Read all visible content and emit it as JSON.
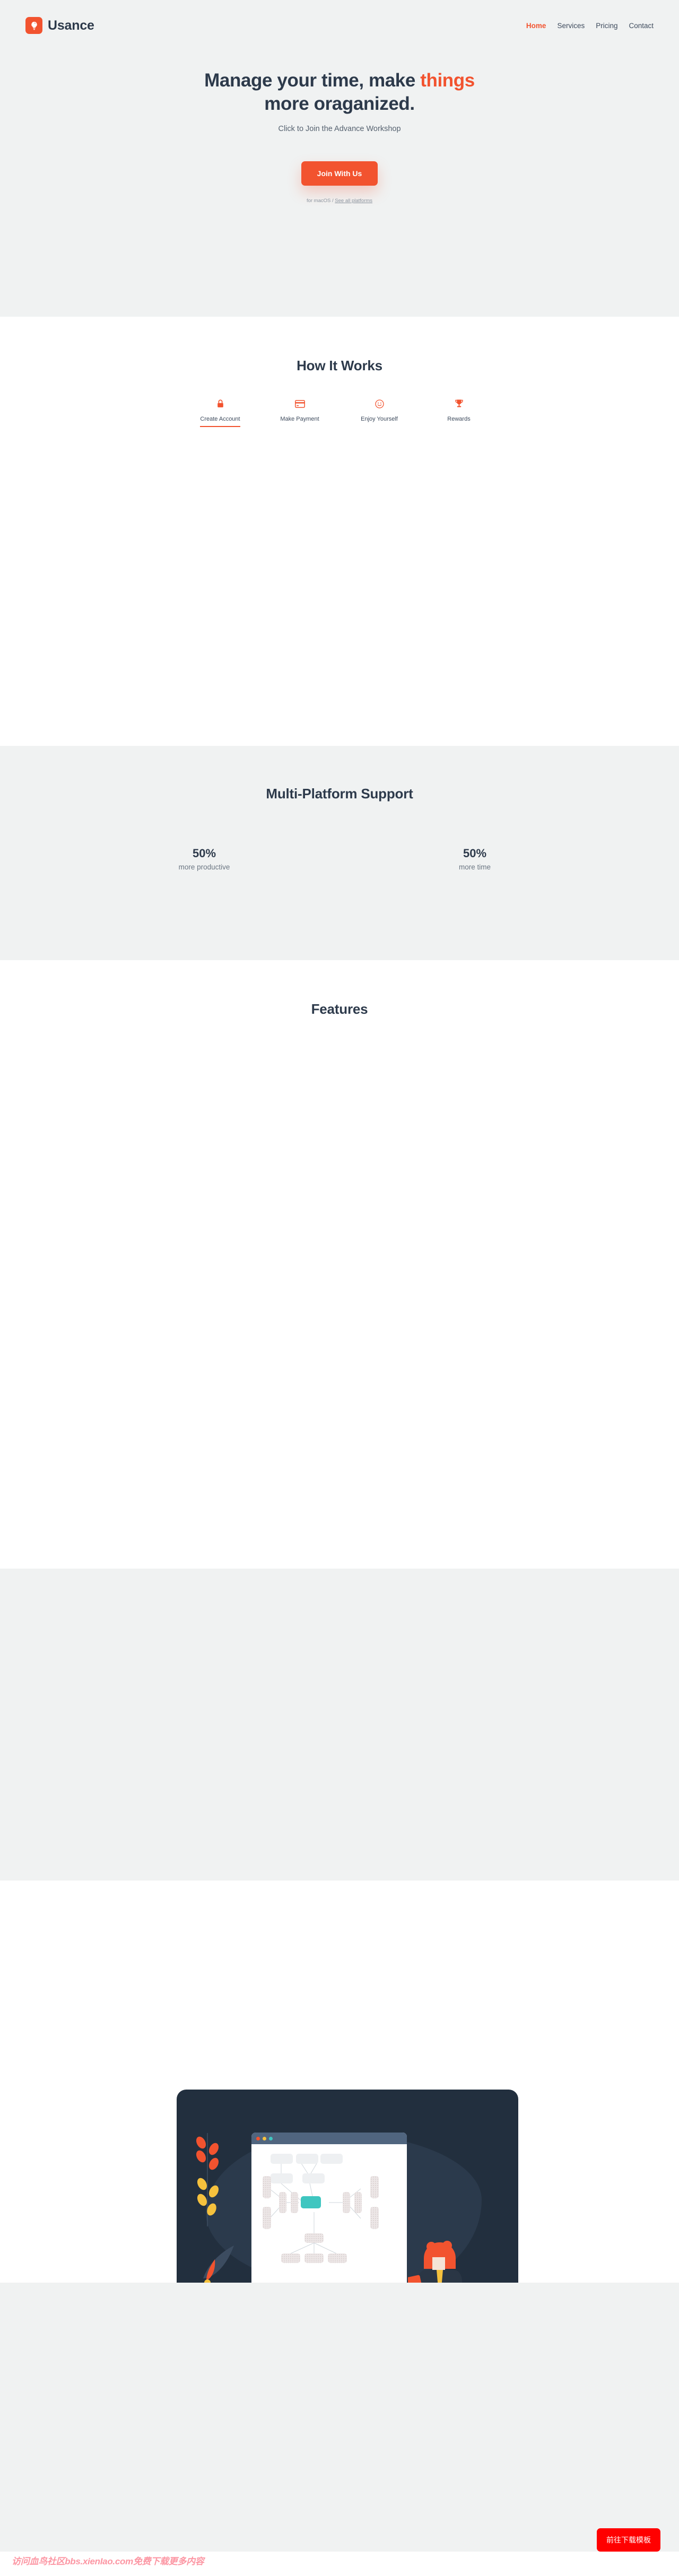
{
  "header": {
    "brand_name": "Usance",
    "logo_icon": "lightbulb-icon",
    "nav": [
      {
        "label": "Home",
        "active": true
      },
      {
        "label": "Services",
        "active": false
      },
      {
        "label": "Pricing",
        "active": false
      },
      {
        "label": "Contact",
        "active": false
      }
    ]
  },
  "hero": {
    "title_part1": "Manage your time, make ",
    "title_accent": "things",
    "title_part2": "more oraganized.",
    "subtitle": "Click to Join the Advance Workshop",
    "cta_label": "Join With Us",
    "note_prefix": "for macOS / ",
    "note_link": "See all platforms"
  },
  "how_it_works": {
    "title": "How It Works",
    "steps": [
      {
        "label": "Create Account",
        "icon": "lock-icon",
        "active": true
      },
      {
        "label": "Make Payment",
        "icon": "credit-card-icon",
        "active": false
      },
      {
        "label": "Enjoy Yourself",
        "icon": "smiley-icon",
        "active": false
      },
      {
        "label": "Rewards",
        "icon": "trophy-icon",
        "active": false
      }
    ]
  },
  "multi_platform": {
    "title": "Multi-Platform Support",
    "stats": [
      {
        "value": "50%",
        "label": "more productive"
      },
      {
        "value": "50%",
        "label": "more time"
      }
    ]
  },
  "features": {
    "title": "Features"
  },
  "showcase": {
    "window_dots": [
      "red",
      "yellow",
      "teal"
    ]
  },
  "overlay": {
    "download_button": "前往下载模板",
    "watermark": "访问血鸟社区bbs.xienIao.com免费下载更多内容"
  },
  "colors": {
    "accent": "#f2532f",
    "dark": "#2d3a4b",
    "band_gray": "#f0f2f2",
    "teal": "#3fc6c0",
    "download_red": "#ff0000",
    "watermark_pink": "#fc8e9c"
  }
}
